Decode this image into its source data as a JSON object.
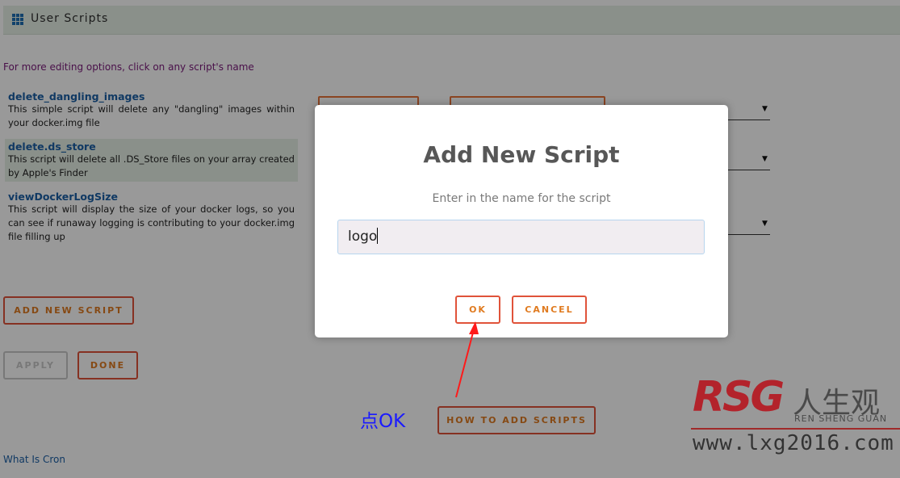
{
  "header": {
    "title": "User Scripts",
    "icon": "grid-icon"
  },
  "hint": "For more editing options, click on any script's name",
  "scripts": [
    {
      "name": "delete_dangling_images",
      "description": "This simple script will delete any \"dangling\" images within your docker.img file"
    },
    {
      "name": "delete.ds_store",
      "description": "This script will delete all .DS_Store files on your array created by Apple's Finder"
    },
    {
      "name": "viewDockerLogSize",
      "description": "This script will display the size of your docker logs, so you can see if runaway logging is contributing to your docker.img file filling up"
    }
  ],
  "buttons": {
    "add_new_script": "ADD NEW SCRIPT",
    "apply": "APPLY",
    "done": "DONE",
    "how_to_add": "HOW TO ADD SCRIPTS"
  },
  "cron_link": "What Is Cron",
  "dialog": {
    "title": "Add New Script",
    "text": "Enter in the name for the script",
    "input_value": "logo",
    "ok": "OK",
    "cancel": "CANCEL"
  },
  "annotation": {
    "text": "点OK",
    "color": "#1a1aff",
    "arrow_color": "#ff1a1a"
  },
  "watermark": {
    "brand": "RSG",
    "chinese": "人生观",
    "english": "REN SHENG GUAN",
    "url": "www.lxg2016.com"
  },
  "colors": {
    "accent_orange": "#e07b20",
    "button_border": "#e0533a",
    "link_blue": "#1b5fa6"
  }
}
